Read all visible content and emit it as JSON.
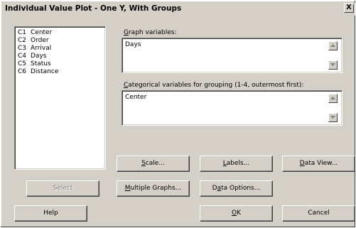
{
  "window": {
    "title": "Individual Value Plot - One Y, With Groups",
    "close_glyph": "X"
  },
  "variables": [
    {
      "col": "C1",
      "name": "Center"
    },
    {
      "col": "C2",
      "name": "Order"
    },
    {
      "col": "C3",
      "name": "Arrival"
    },
    {
      "col": "C4",
      "name": "Days"
    },
    {
      "col": "C5",
      "name": "Status"
    },
    {
      "col": "C6",
      "name": "Distance"
    }
  ],
  "graph_variables": {
    "label_hotkey": "G",
    "label_rest": "raph variables:",
    "value": "Days"
  },
  "categorical_variables": {
    "label_hotkey": "C",
    "label_rest": "ategorical variables for grouping (1-4, outermost first):",
    "value": "Center"
  },
  "buttons": {
    "scale": {
      "hotkey": "S",
      "rest": "cale..."
    },
    "labels": {
      "hotkey": "L",
      "rest": "abels..."
    },
    "data_view": {
      "hotkey": "D",
      "rest": "ata View..."
    },
    "select": {
      "label": "Select"
    },
    "multiple_graphs": {
      "hotkey": "M",
      "rest": "ultiple Graphs..."
    },
    "data_options": {
      "pre": "D",
      "hotkey": "a",
      "rest": "ta Options..."
    },
    "help": {
      "label": "Help"
    },
    "ok": {
      "hotkey": "O",
      "rest": "K"
    },
    "cancel": {
      "label": "Cancel"
    }
  },
  "colors": {
    "dialog_face": "#d4d0c8",
    "field_background": "#ffffff",
    "disabled_text": "#808080"
  }
}
